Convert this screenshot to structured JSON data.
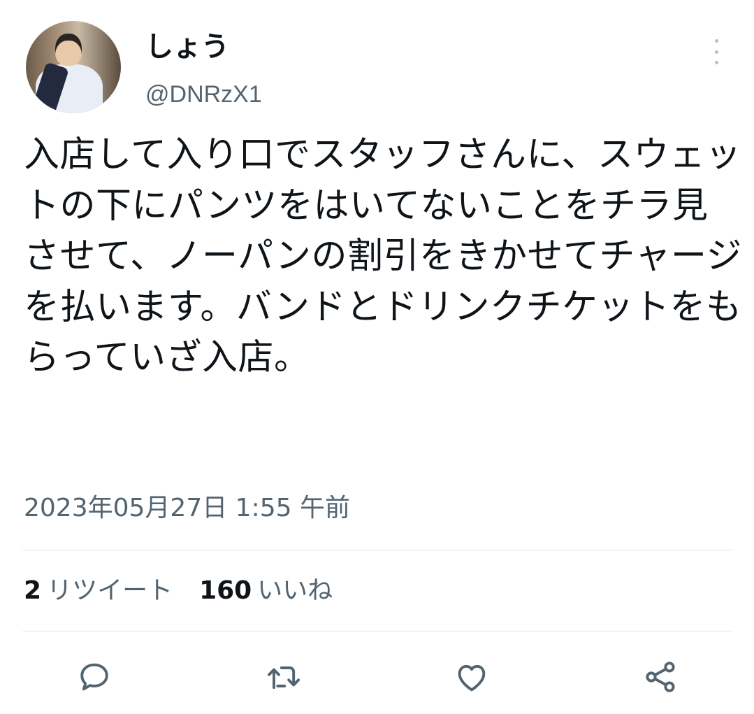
{
  "author": {
    "display_name": "しょう",
    "handle": "@DNRzX1"
  },
  "tweet": {
    "text": "入店して入り口でスタッフさんに、スウェットの下にパンツをはいてないことをチラ見させて、ノーパンの割引をきかせてチャージを払います。バンドとドリンクチケットをもらっていざ入店。",
    "timestamp": "2023年05月27日 1:55 午前"
  },
  "stats": {
    "retweets_count": "2",
    "retweets_label": "リツイート",
    "likes_count": "160",
    "likes_label": "いいね"
  },
  "actions": {
    "reply_icon": "reply-icon",
    "retweet_icon": "retweet-icon",
    "like_icon": "heart-icon",
    "share_icon": "share-icon"
  },
  "colors": {
    "text": "#0f1419",
    "secondary": "#536471",
    "divider": "#e1e6ea",
    "icon": "#536471"
  }
}
